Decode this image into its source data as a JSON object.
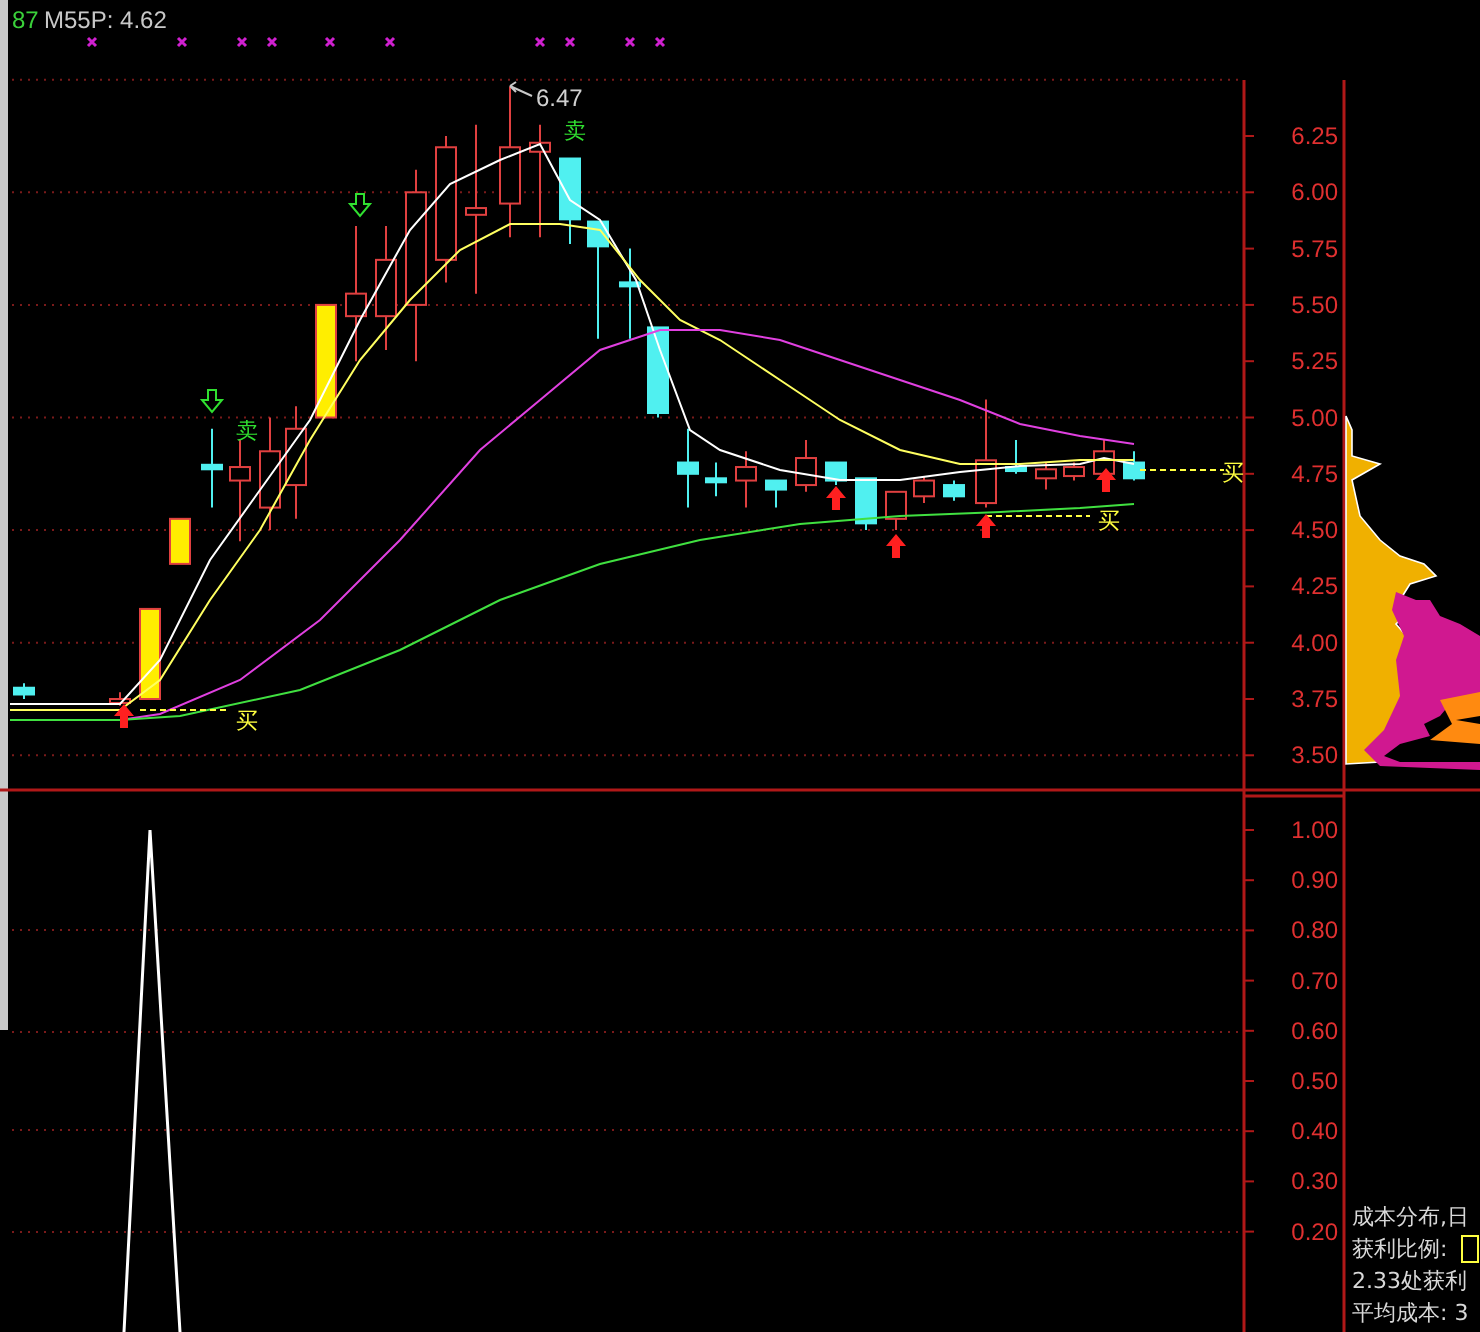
{
  "legend": {
    "series_tag": "87",
    "indicator": "M55P: 4.62"
  },
  "price_chart": {
    "high_label": "6.47",
    "signals": [
      {
        "kind": "sell",
        "text": "卖"
      },
      {
        "kind": "sell",
        "text": "卖"
      },
      {
        "kind": "buy",
        "text": "买"
      },
      {
        "kind": "buy",
        "text": "买"
      },
      {
        "kind": "buy",
        "text": "买"
      }
    ],
    "y_ticks": [
      "6.25",
      "6.00",
      "5.75",
      "5.50",
      "5.25",
      "5.00",
      "4.75",
      "4.50",
      "4.25",
      "4.00",
      "3.75",
      "3.50"
    ]
  },
  "indicator_chart": {
    "y_ticks": [
      "1.00",
      "0.90",
      "0.80",
      "0.70",
      "0.60",
      "0.50",
      "0.40",
      "0.30",
      "0.20"
    ]
  },
  "cost_panel": {
    "lines": [
      {
        "kind": "text",
        "text": "成本分布,日"
      },
      {
        "kind": "field",
        "text": "获利比例:"
      },
      {
        "kind": "text",
        "text": "2.33处获利"
      },
      {
        "kind": "text",
        "text": "平均成本: 3"
      }
    ]
  }
}
